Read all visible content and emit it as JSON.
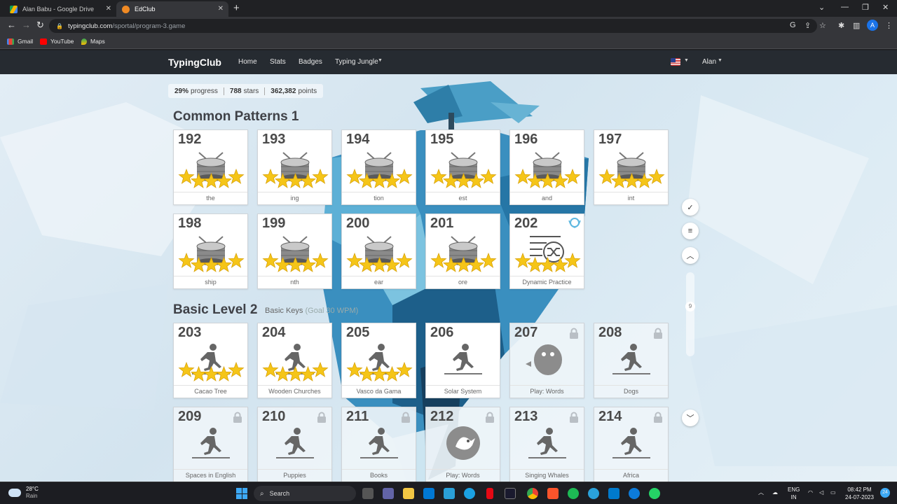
{
  "browser": {
    "tabs": [
      {
        "title": "Alan Babu - Google Drive",
        "active": false
      },
      {
        "title": "EdClub",
        "active": true
      }
    ],
    "url_host": "typingclub.com",
    "url_path": "/sportal/program-3.game",
    "profile_initial": "A",
    "bookmarks": [
      "Gmail",
      "YouTube",
      "Maps"
    ]
  },
  "site": {
    "brand": "TypingClub",
    "nav": [
      "Home",
      "Stats",
      "Badges",
      "Typing Jungle"
    ],
    "user": "Alan"
  },
  "progress": {
    "percent": "29%",
    "percent_label": "progress",
    "stars": "788",
    "stars_label": "stars",
    "points": "362,382",
    "points_label": "points"
  },
  "sections": [
    {
      "title": "Common Patterns 1",
      "subtitle": "",
      "lessons": [
        {
          "num": "192",
          "label": "the",
          "stars": 5,
          "icon": "drum-icon",
          "locked": false
        },
        {
          "num": "193",
          "label": "ing",
          "stars": 5,
          "icon": "drum-icon",
          "locked": false
        },
        {
          "num": "194",
          "label": "tion",
          "stars": 5,
          "icon": "drum-icon",
          "locked": false
        },
        {
          "num": "195",
          "label": "est",
          "stars": 5,
          "icon": "drum-icon",
          "locked": false
        },
        {
          "num": "196",
          "label": "and",
          "stars": 5,
          "icon": "drum-icon",
          "locked": false
        },
        {
          "num": "197",
          "label": "int",
          "stars": 5,
          "icon": "drum-icon",
          "locked": false
        },
        {
          "num": "198",
          "label": "ship",
          "stars": 5,
          "icon": "drum-icon",
          "locked": false
        },
        {
          "num": "199",
          "label": "nth",
          "stars": 5,
          "icon": "drum-icon",
          "locked": false
        },
        {
          "num": "200",
          "label": "ear",
          "stars": 5,
          "icon": "drum-icon",
          "locked": false
        },
        {
          "num": "201",
          "label": "ore",
          "stars": 5,
          "icon": "drum-icon",
          "locked": false
        },
        {
          "num": "202",
          "label": "Dynamic Practice",
          "stars": 5,
          "icon": "shuffle-list-icon",
          "locked": false
        }
      ]
    },
    {
      "title": "Basic Level 2",
      "subtitle": "Basic Keys",
      "goal": "(Goal 30 WPM)",
      "lessons": [
        {
          "num": "203",
          "label": "Cacao Tree",
          "stars": 5,
          "icon": "runner-icon",
          "locked": false
        },
        {
          "num": "204",
          "label": "Wooden Churches",
          "stars": 5,
          "icon": "runner-icon",
          "locked": false
        },
        {
          "num": "205",
          "label": "Vasco da Gama",
          "stars": 5,
          "icon": "runner-icon",
          "locked": false
        },
        {
          "num": "206",
          "label": "Solar System",
          "stars": 0,
          "icon": "runner-icon",
          "locked": false
        },
        {
          "num": "207",
          "label": "Play: Words",
          "stars": 0,
          "icon": "monster-icon",
          "locked": true
        },
        {
          "num": "208",
          "label": "Dogs",
          "stars": 0,
          "icon": "runner-icon",
          "locked": true
        },
        {
          "num": "209",
          "label": "Spaces in English",
          "stars": 0,
          "icon": "runner-icon",
          "locked": true
        },
        {
          "num": "210",
          "label": "Puppies",
          "stars": 0,
          "icon": "runner-icon",
          "locked": true
        },
        {
          "num": "211",
          "label": "Books",
          "stars": 0,
          "icon": "runner-icon",
          "locked": true
        },
        {
          "num": "212",
          "label": "Play: Words",
          "stars": 0,
          "icon": "bird-icon",
          "locked": true
        },
        {
          "num": "213",
          "label": "Singing Whales",
          "stars": 0,
          "icon": "runner-icon",
          "locked": true
        },
        {
          "num": "214",
          "label": "Africa",
          "stars": 0,
          "icon": "runner-icon",
          "locked": true
        }
      ]
    }
  ],
  "side": {
    "page_indicator": "9"
  },
  "taskbar": {
    "temp": "28°C",
    "weather": "Rain",
    "search": "Search",
    "lang1": "ENG",
    "lang2": "IN",
    "time": "08:42 PM",
    "date": "24-07-2023",
    "notifications": "24"
  },
  "colors": {
    "star": "#f5c518",
    "star_edge": "#d9a30a",
    "nav_bg": "#262b31",
    "accent_blue": "#3da9f5"
  }
}
